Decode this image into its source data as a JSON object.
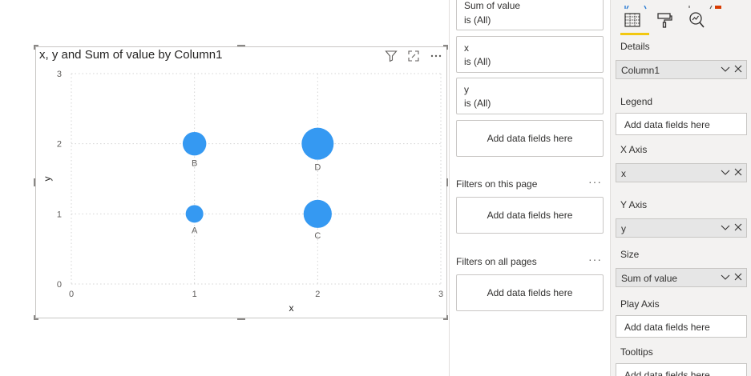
{
  "visual": {
    "title": "x, y and Sum of value by Column1"
  },
  "chart_data": {
    "type": "scatter",
    "title": "x, y and Sum of value by Column1",
    "xlabel": "x",
    "ylabel": "y",
    "xlim": [
      0,
      3
    ],
    "ylim": [
      0,
      3
    ],
    "x_ticks": [
      "0",
      "1",
      "2",
      "3"
    ],
    "y_ticks": [
      "0",
      "1",
      "2",
      "3"
    ],
    "grid": true,
    "points": [
      {
        "label": "A",
        "x": 1,
        "y": 1,
        "size": 1
      },
      {
        "label": "B",
        "x": 1,
        "y": 2,
        "size": 2
      },
      {
        "label": "C",
        "x": 2,
        "y": 1,
        "size": 3
      },
      {
        "label": "D",
        "x": 2,
        "y": 2,
        "size": 4
      }
    ],
    "color": "#3599f2"
  },
  "filters": {
    "cards": [
      {
        "name": "Sum of value",
        "value": "is (All)"
      },
      {
        "name": "x",
        "value": "is (All)"
      },
      {
        "name": "y",
        "value": "is (All)"
      }
    ],
    "add_visual_label": "Add data fields here",
    "page_section": "Filters on this page",
    "page_add_label": "Add data fields here",
    "all_section": "Filters on all pages",
    "all_add_label": "Add data fields here",
    "more": "···"
  },
  "viz_pane": {
    "wells": {
      "details_label": "Details",
      "details_value": "Column1",
      "legend_label": "Legend",
      "legend_placeholder": "Add data fields here",
      "xaxis_label": "X Axis",
      "xaxis_value": "x",
      "yaxis_label": "Y Axis",
      "yaxis_value": "y",
      "size_label": "Size",
      "size_value": "Sum of value",
      "play_label": "Play Axis",
      "play_placeholder": "Add data fields here",
      "tooltips_label": "Tooltips",
      "tooltips_placeholder": "Add data fields here"
    },
    "accent": "#f2c811"
  }
}
